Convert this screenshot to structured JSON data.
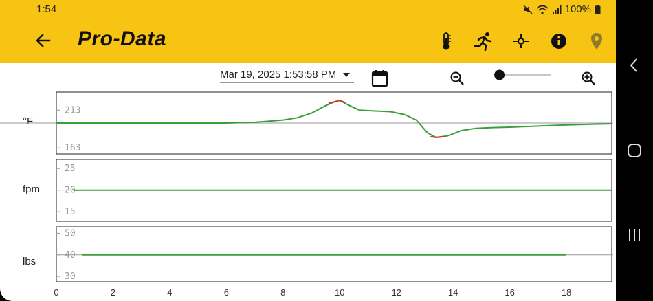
{
  "status": {
    "time": "1:54",
    "battery": "100%"
  },
  "app": {
    "title": "Pro-Data"
  },
  "toolbar": {
    "icons": [
      "thermometer-icon",
      "runner-icon",
      "sensor-icon",
      "info-icon",
      "location-pin-icon"
    ]
  },
  "date_selector": {
    "value": "Mar 19, 2025 1:53:58 PM"
  },
  "zoom": {
    "level": 0.1
  },
  "colors": {
    "accent": "#F8C414",
    "line": "#3A9E3A",
    "alert": "#D03A2A",
    "grid": "#9A9A9A"
  },
  "chart_data": [
    {
      "type": "line",
      "ylabel": "°F",
      "yticks": [
        213,
        163
      ],
      "ylim": [
        155,
        237
      ],
      "xlim": [
        0,
        19.6
      ],
      "reference_line": 196,
      "series": [
        {
          "points": [
            [
              0,
              196
            ],
            [
              6,
              196
            ],
            [
              7,
              197
            ],
            [
              8,
              200
            ],
            [
              8.5,
              203
            ],
            [
              9,
              209
            ],
            [
              9.5,
              219
            ],
            [
              9.8,
              224
            ],
            [
              10,
              226
            ],
            [
              10.3,
              220
            ],
            [
              10.7,
              213
            ],
            [
              11.2,
              212
            ],
            [
              11.8,
              211
            ],
            [
              12.3,
              207
            ],
            [
              12.7,
              200
            ],
            [
              13.1,
              183
            ],
            [
              13.4,
              177
            ],
            [
              13.8,
              179
            ],
            [
              14.3,
              186
            ],
            [
              14.8,
              189
            ],
            [
              15.4,
              190
            ],
            [
              16,
              190.5
            ],
            [
              17,
              192
            ],
            [
              18,
              193.5
            ],
            [
              19,
              194.5
            ],
            [
              19.6,
              195
            ]
          ],
          "alert_segments": [
            [
              [
                9.6,
                222
              ],
              [
                10,
                226
              ],
              [
                10.2,
                223
              ]
            ],
            [
              [
                13.2,
                178
              ],
              [
                13.4,
                177
              ],
              [
                13.7,
                178
              ]
            ]
          ]
        }
      ]
    },
    {
      "type": "line",
      "ylabel": "fpm",
      "yticks": [
        25,
        20,
        15
      ],
      "ylim": [
        12.8,
        27.1
      ],
      "xlim": [
        0,
        19.6
      ],
      "reference_line": 20,
      "series": [
        {
          "points": [
            [
              0.6,
              20
            ],
            [
              19.6,
              20
            ]
          ]
        }
      ]
    },
    {
      "type": "line",
      "ylabel": "lbs",
      "yticks": [
        50,
        40,
        30
      ],
      "ylim": [
        27.5,
        53
      ],
      "xlim": [
        0,
        19.6
      ],
      "reference_line": 40,
      "series": [
        {
          "points": [
            [
              0.9,
              40
            ],
            [
              18,
              40
            ]
          ]
        }
      ],
      "xticks": [
        0,
        2,
        4,
        6,
        8,
        10,
        12,
        14,
        16,
        18
      ]
    }
  ]
}
